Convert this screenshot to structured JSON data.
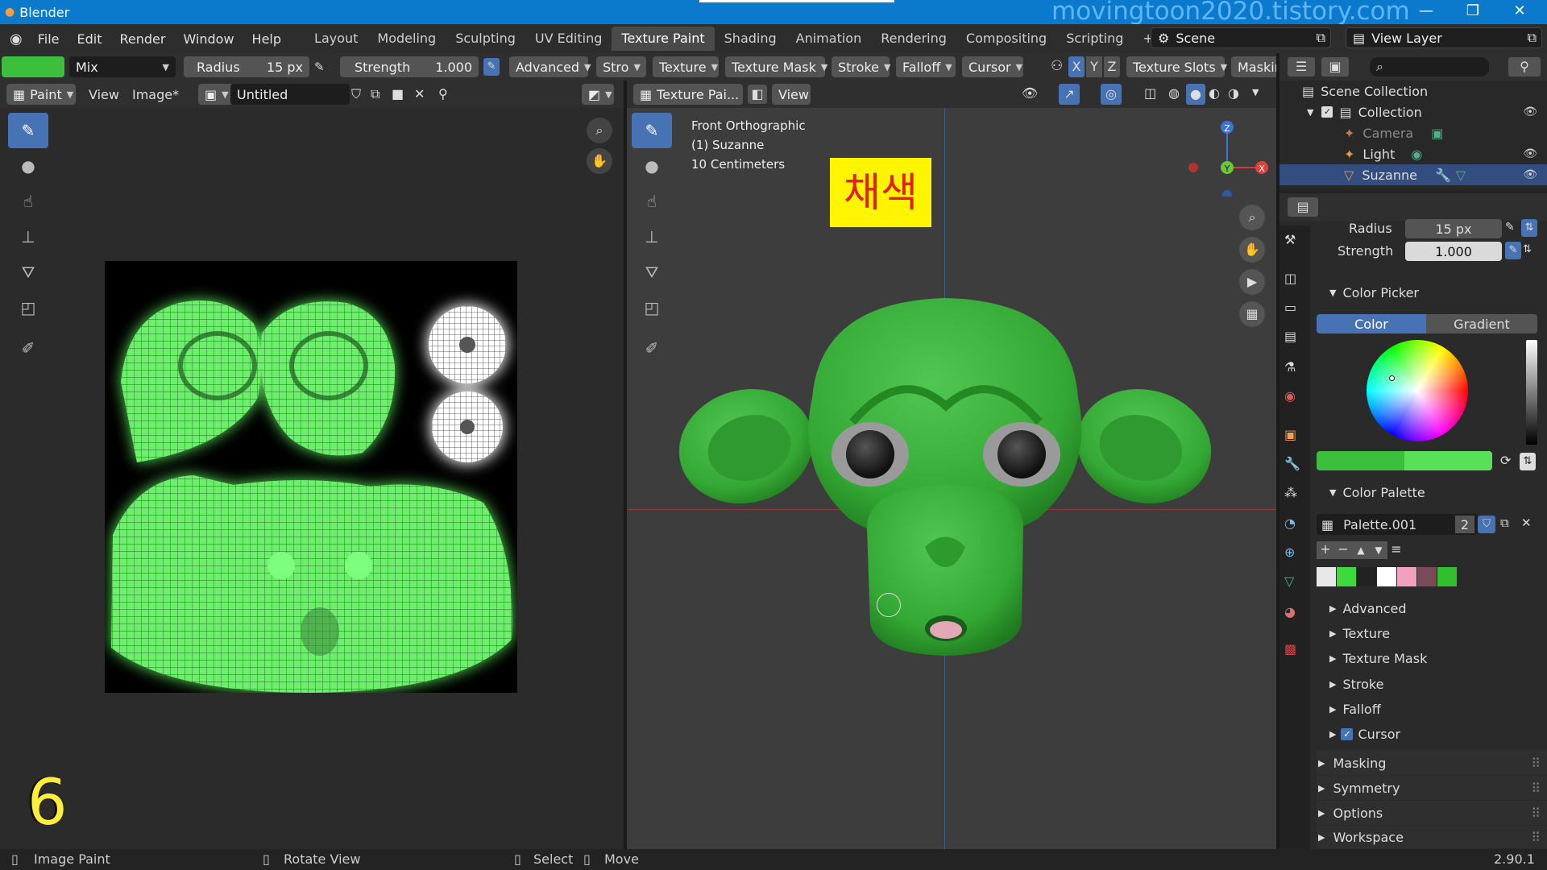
{
  "app": {
    "title": "Blender",
    "watermark": "movingtoon2020.tistory.com",
    "version": "2.90.1"
  },
  "menu": [
    "File",
    "Edit",
    "Render",
    "Window",
    "Help"
  ],
  "workspaces": [
    "Layout",
    "Modeling",
    "Sculpting",
    "UV Editing",
    "Texture Paint",
    "Shading",
    "Animation",
    "Rendering",
    "Compositing",
    "Scripting"
  ],
  "active_workspace": "Texture Paint",
  "scene": {
    "name": "Scene",
    "view_layer": "View Layer"
  },
  "toolheader": {
    "blend": "Mix",
    "radius_label": "Radius",
    "radius_value": "15 px",
    "strength_label": "Strength",
    "strength_value": "1.000",
    "advanced": "Advanced",
    "stroke_short": "Stro",
    "texture": "Texture",
    "texture_mask": "Texture Mask",
    "stroke": "Stroke",
    "falloff": "Falloff",
    "cursor": "Cursor",
    "axes": [
      "X",
      "Y",
      "Z"
    ],
    "texture_slots": "Texture Slots",
    "masking": "Maskin",
    "color": "#3cbf3c"
  },
  "image_editor": {
    "mode": "Paint",
    "view": "View",
    "image_menu": "Image*",
    "image_name": "Untitled"
  },
  "viewport": {
    "header_mode": "Texture Pai...",
    "view": "View",
    "overlay_lines": [
      "Front Orthographic",
      "(1) Suzanne",
      "10 Centimeters"
    ],
    "korean_label": "채색",
    "gizmo_axes": {
      "z": "Z",
      "y": "Y",
      "x": "X"
    }
  },
  "outliner": {
    "root": "Scene Collection",
    "collection": "Collection",
    "items": [
      "Camera",
      "Light",
      "Suzanne"
    ]
  },
  "properties": {
    "radius_label": "Radius",
    "radius_value": "15 px",
    "strength_label": "Strength",
    "strength_value": "1.000",
    "color_picker": "Color Picker",
    "tab_color": "Color",
    "tab_gradient": "Gradient",
    "color_palette": "Color Palette",
    "palette_name": "Palette.001",
    "palette_users": "2",
    "palette_colors": [
      "#e8e8e8",
      "#3dd93d",
      "#222222",
      "#ffffff",
      "#f2a0bf",
      "#7a4a58",
      "#2fbf2f"
    ],
    "brush_subpanels": [
      "Advanced",
      "Texture",
      "Texture Mask",
      "Stroke",
      "Falloff",
      "Cursor"
    ],
    "panels": [
      "Masking",
      "Symmetry",
      "Options",
      "Workspace"
    ]
  },
  "statusbar": {
    "items": [
      "Image Paint",
      "Rotate View",
      "Select",
      "Move"
    ]
  },
  "overlay_number": "6"
}
